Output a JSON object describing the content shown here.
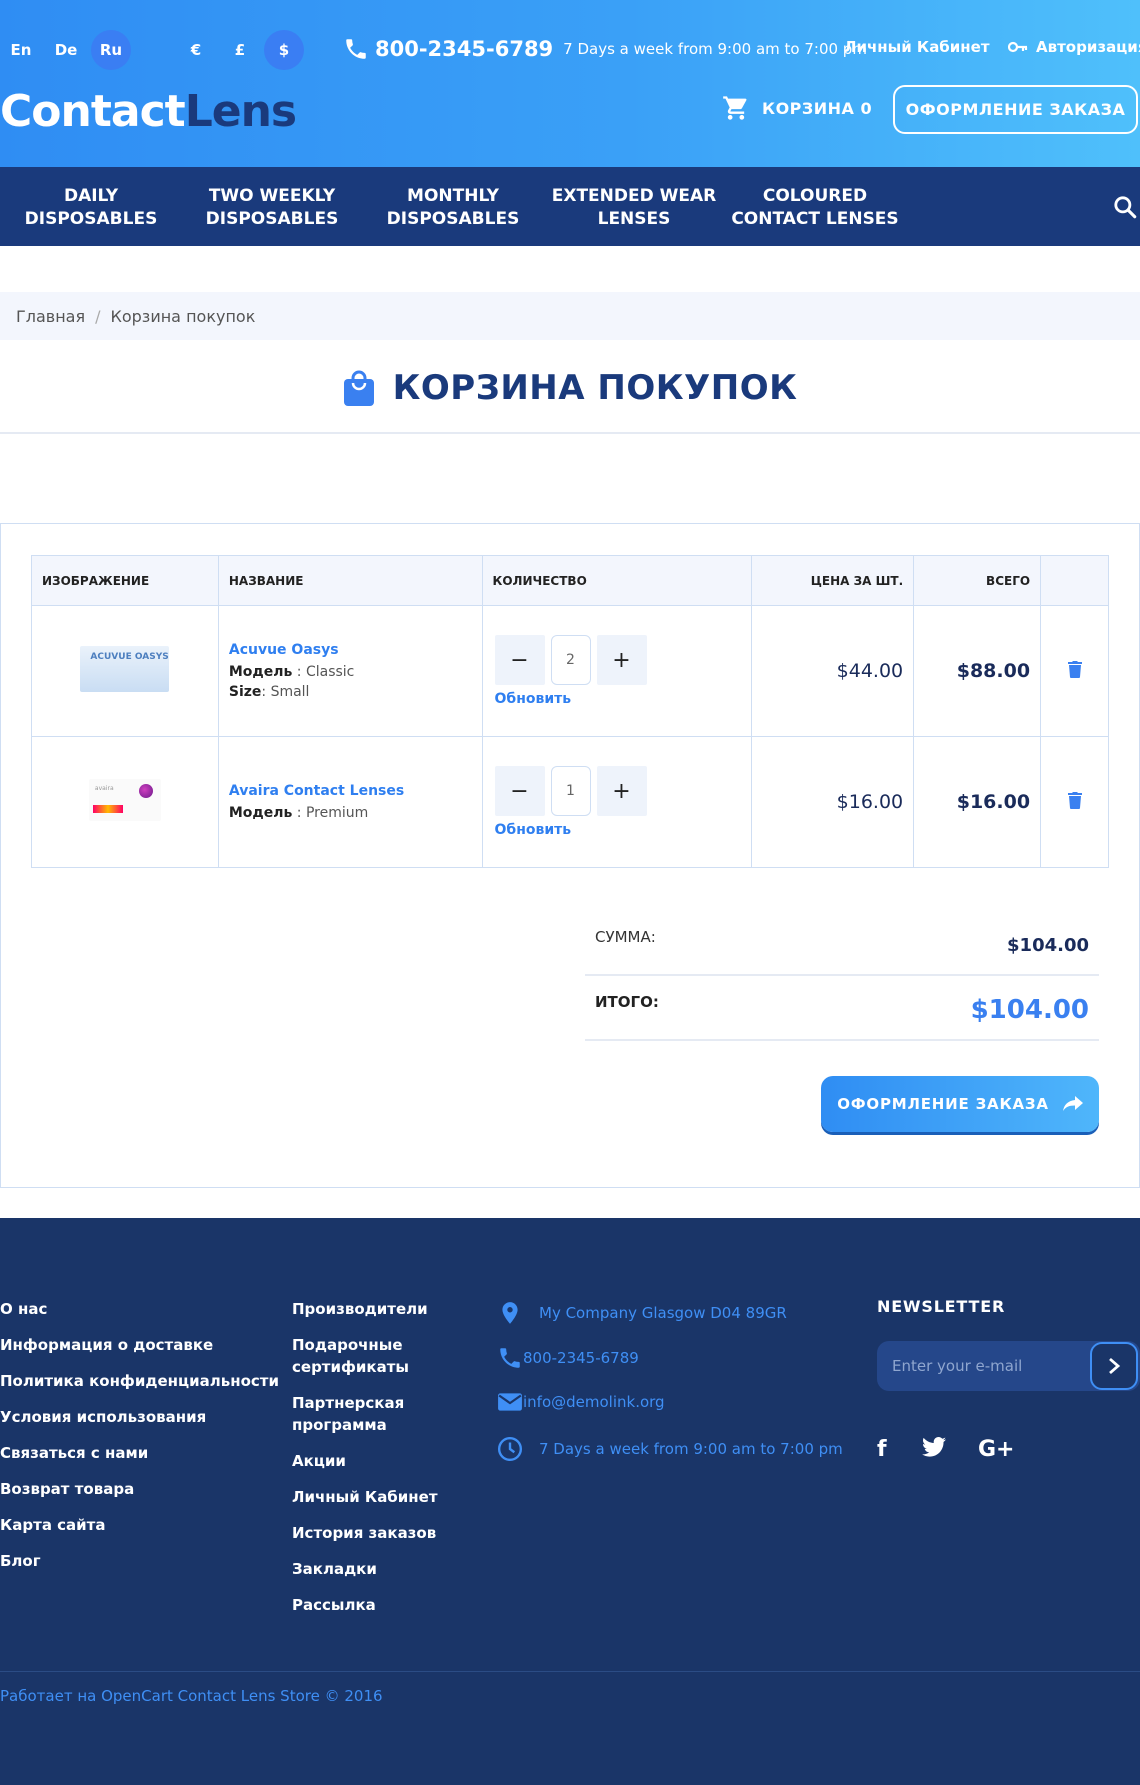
{
  "header": {
    "languages": [
      "En",
      "De",
      "Ru"
    ],
    "active_language": "Ru",
    "currencies": [
      "€",
      "£",
      "$"
    ],
    "active_currency": "$",
    "phone": "800-2345-6789",
    "hours": "7 Days a week from 9:00 am to 7:00 pm",
    "account_link": "Личный Кабинет",
    "login_link": "Авторизация",
    "logo_part1": "Contact",
    "logo_part2": "Lens",
    "cart_label": "КОРЗИНА 0",
    "checkout_label": "ОФОРМЛЕНИЕ ЗАКАЗА"
  },
  "nav": {
    "items": [
      {
        "line1": "DAILY",
        "line2": "DISPOSABLES"
      },
      {
        "line1": "TWO WEEKLY",
        "line2": "DISPOSABLES"
      },
      {
        "line1": "MONTHLY",
        "line2": "DISPOSABLES"
      },
      {
        "line1": "EXTENDED WEAR",
        "line2": "LENSES"
      },
      {
        "line1": "COLOURED",
        "line2": "CONTACT LENSES"
      }
    ]
  },
  "breadcrumb": [
    "Главная",
    "Корзина покупок"
  ],
  "page_title": "КОРЗИНА ПОКУПОК",
  "table": {
    "headers": [
      "ИЗОБРАЖЕНИЕ",
      "НАЗВАНИЕ",
      "КОЛИЧЕСТВО",
      "ЦЕНА ЗА ШТ.",
      "ВСЕГО"
    ],
    "rows": [
      {
        "image_text": "ACUVUE OASYS",
        "name": "Acuvue Oasys",
        "model_label": "Модель",
        "model": "Classic",
        "size_label": "Size",
        "size": "Small",
        "qty": "2",
        "update": "Обновить",
        "price": "$44.00",
        "total": "$88.00"
      },
      {
        "image_text": "avaira",
        "name": "Avaira Contact Lenses",
        "model_label": "Модель",
        "model": "Premium",
        "qty": "1",
        "update": "Обновить",
        "price": "$16.00",
        "total": "$16.00"
      }
    ]
  },
  "summary": {
    "subtotal_label": "СУММА:",
    "subtotal": "$104.00",
    "total_label": "ИТОГО:",
    "total": "$104.00"
  },
  "checkout_button": "ОФОРМЛЕНИЕ ЗАКАЗА",
  "footer": {
    "col1": [
      "О нас",
      "Информация о доставке",
      "Политика конфиденциальности",
      "Условия использования",
      "Связаться с нами",
      "Возврат товара",
      "Карта сайта",
      "Блог"
    ],
    "col2": [
      "Производители",
      "Подарочные сертификаты",
      "Партнерская программа",
      "Акции",
      "Личный Кабинет",
      "История заказов",
      "Закладки",
      "Рассылка"
    ],
    "address": "My Company Glasgow D04 89GR",
    "phone": "800-2345-6789",
    "email": "info@demolink.org",
    "hours": "7 Days a week from 9:00 am to 7:00 pm",
    "newsletter_title": "NEWSLETTER",
    "newsletter_placeholder": "Enter your e-mail",
    "copyright": "Работает на OpenCart Contact Lens Store © 2016"
  },
  "colors": {
    "accent": "#2f7ff0",
    "navy": "#1a3a7c",
    "footer": "#1a3568"
  }
}
